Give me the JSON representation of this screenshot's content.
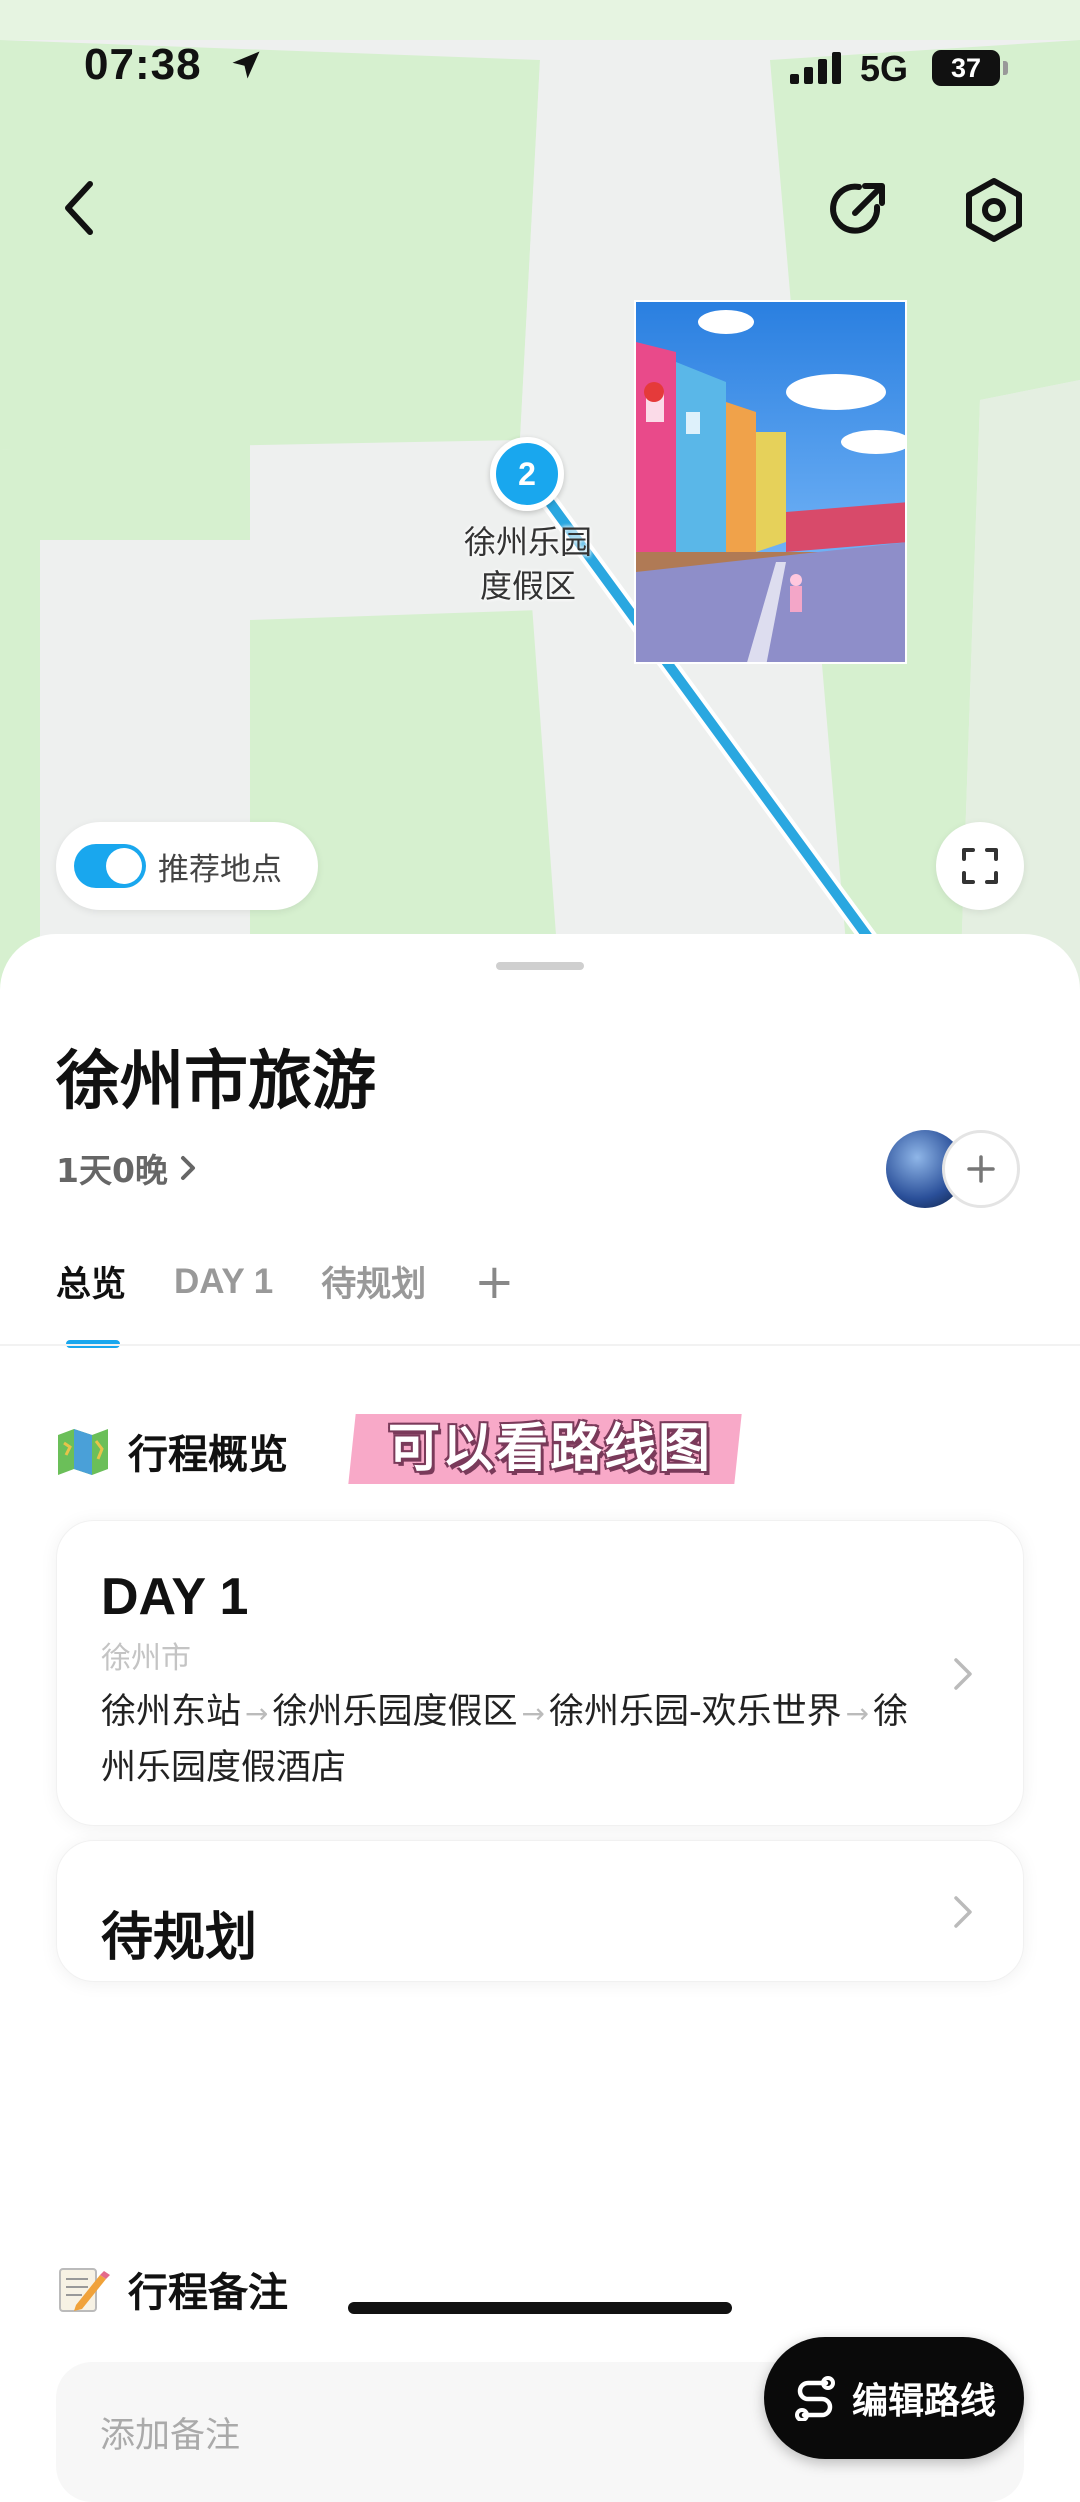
{
  "status_bar": {
    "time": "07:38",
    "network": "5G",
    "battery": "37"
  },
  "map": {
    "pin_number": "2",
    "pin_label": "徐州乐园\n度假区",
    "recommend_toggle_label": "推荐地点",
    "recommend_toggle_on": true
  },
  "trip": {
    "title": "徐州市旅游",
    "duration": "1天0晚"
  },
  "tabs": {
    "overview": "总览",
    "day1": "DAY 1",
    "pending": "待规划",
    "add": "+"
  },
  "overview": {
    "section_title": "行程概览",
    "sticker_text": "可以看路线图",
    "day_card": {
      "title": "DAY 1",
      "city": "徐州市",
      "stops": [
        "徐州东站",
        "徐州乐园度假区",
        "徐州乐园-欢乐世界",
        "徐州乐园度假酒店"
      ]
    },
    "pending_card": {
      "title": "待规划"
    }
  },
  "notes": {
    "section_title": "行程备注",
    "placeholder": "添加备注"
  },
  "actions": {
    "edit_route": "编辑路线"
  },
  "colors": {
    "accent": "#19a7ee",
    "sticker": "#f8a9c8",
    "map_green": "#d6f0cf"
  }
}
